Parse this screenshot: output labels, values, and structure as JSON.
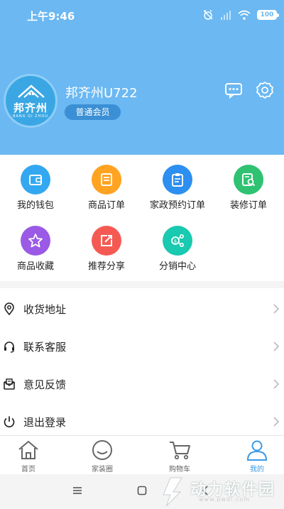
{
  "status_bar": {
    "time": "上午9:46",
    "battery": "100",
    "icons": [
      "alarm-off-icon",
      "signal-icon",
      "wifi-icon",
      "battery-icon"
    ]
  },
  "profile": {
    "avatar_text": "邦齐州",
    "avatar_subtext": "BANG QI ZHOU",
    "username": "邦齐州U722",
    "member_level": "普通会员",
    "icons": [
      "message-icon",
      "settings-icon"
    ]
  },
  "quick_actions": [
    {
      "label": "我的钱包",
      "icon": "wallet-icon",
      "color": "#33a8f0"
    },
    {
      "label": "商品订单",
      "icon": "order-icon",
      "color": "#ffa321"
    },
    {
      "label": "家政预约订单",
      "icon": "clipboard-icon",
      "color": "#2d8ff0"
    },
    {
      "label": "装修订单",
      "icon": "search-document-icon",
      "color": "#2ec272"
    },
    {
      "label": "商品收藏",
      "icon": "star-icon",
      "color": "#9a5ae6"
    },
    {
      "label": "推荐分享",
      "icon": "share-icon",
      "color": "#f45a52"
    },
    {
      "label": "分销中心",
      "icon": "distribution-icon",
      "color": "#19c9b0"
    }
  ],
  "menu": [
    {
      "label": "收货地址",
      "icon": "location-icon"
    },
    {
      "label": "联系客服",
      "icon": "headset-icon"
    },
    {
      "label": "意见反馈",
      "icon": "feedback-icon"
    },
    {
      "label": "退出登录",
      "icon": "power-icon"
    }
  ],
  "tabs": [
    {
      "label": "首页",
      "icon": "home-icon",
      "active": false
    },
    {
      "label": "家装圈",
      "icon": "chat-circle-icon",
      "active": false
    },
    {
      "label": "购物车",
      "icon": "cart-icon",
      "active": false
    },
    {
      "label": "我的",
      "icon": "user-icon",
      "active": true
    }
  ],
  "watermark": {
    "text": "动力软件园",
    "url": "www.pwdl.com"
  },
  "colors": {
    "header": "#6bb8f2",
    "accent": "#3a9ae6",
    "badge": "#3b8fd4"
  }
}
